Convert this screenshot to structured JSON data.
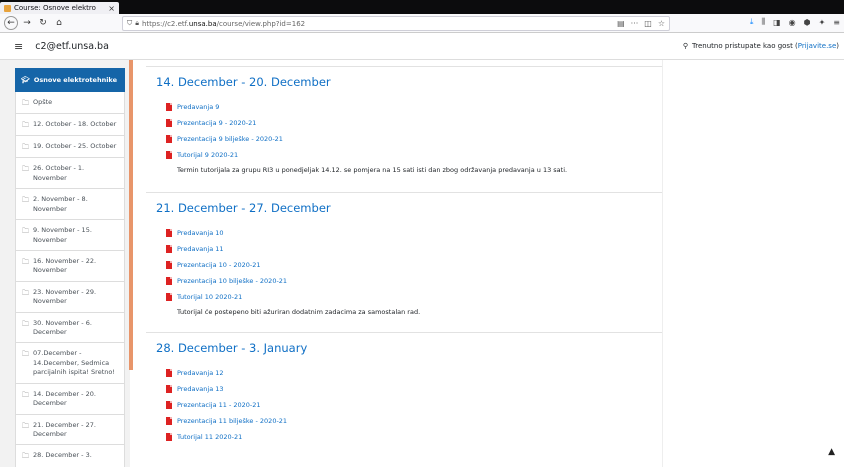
{
  "browser": {
    "tab_title": "Course: Osnove elektro",
    "url_prefix": "https://c2.etf.",
    "url_domain": "unsa.ba",
    "url_suffix": "/course/view.php?id=162",
    "url_menu": "···"
  },
  "header": {
    "site_name": "c2@etf.unsa.ba",
    "guest_text": "Trenutno pristupate kao gost (",
    "login_link": "Prijavite.se",
    "guest_close": ")"
  },
  "drawer": {
    "active_label": "Osnove elektrotehnike",
    "items": [
      {
        "label": "Opšte"
      },
      {
        "label": "12. October - 18. October"
      },
      {
        "label": "19. October - 25. October"
      },
      {
        "label": "26. October - 1. November"
      },
      {
        "label": "2. November - 8. November"
      },
      {
        "label": "9. November - 15. November"
      },
      {
        "label": "16. November - 22. November"
      },
      {
        "label": "23. November - 29. November"
      },
      {
        "label": "30. November - 6. December"
      },
      {
        "label": "07.December - 14.December, Sedmica parcijalnih ispita! Sretno!"
      },
      {
        "label": "14. December - 20. December"
      },
      {
        "label": "21. December - 27. December"
      },
      {
        "label": "28. December - 3."
      }
    ]
  },
  "sections": [
    {
      "title": "14. December - 20. December",
      "activities": [
        "Predavanja 9",
        "Prezentacija 9 - 2020-21",
        "Prezentacija 9 bilješke - 2020-21",
        "Tutorijal 9 2020-21"
      ],
      "summary": "Termin tutorijala za grupu RI3 u ponedjeljak 14.12. se pomjera na 15 sati isti dan zbog održavanja predavanja u 13 sati."
    },
    {
      "title": "21. December - 27. December",
      "activities": [
        "Predavanja 10",
        "Predavanja 11",
        "Prezentacija 10 - 2020-21",
        "Prezentacija 10 bilješke - 2020-21",
        "Tutorijal 10 2020-21"
      ],
      "summary": "Tutorijal će postepeno biti ažuriran dodatnim zadacima za samostalan rad."
    },
    {
      "title": "28. December - 3. January",
      "activities": [
        "Predavanja 12",
        "Predavanja 13",
        "Prezentacija 11 - 2020-21",
        "Prezentacija 11 bilješke - 2020-21",
        "Tutorijal 11 2020-21"
      ],
      "summary": ""
    }
  ],
  "icons": {
    "tab_favicon": "moodle-favicon-icon",
    "back": "back-arrow-icon",
    "forward": "forward-arrow-icon",
    "reload": "reload-icon",
    "home": "home-icon",
    "lock": "lock-icon",
    "pdf": "pdf-icon",
    "folder": "folder-icon",
    "to_top": "arrow-up-icon"
  }
}
